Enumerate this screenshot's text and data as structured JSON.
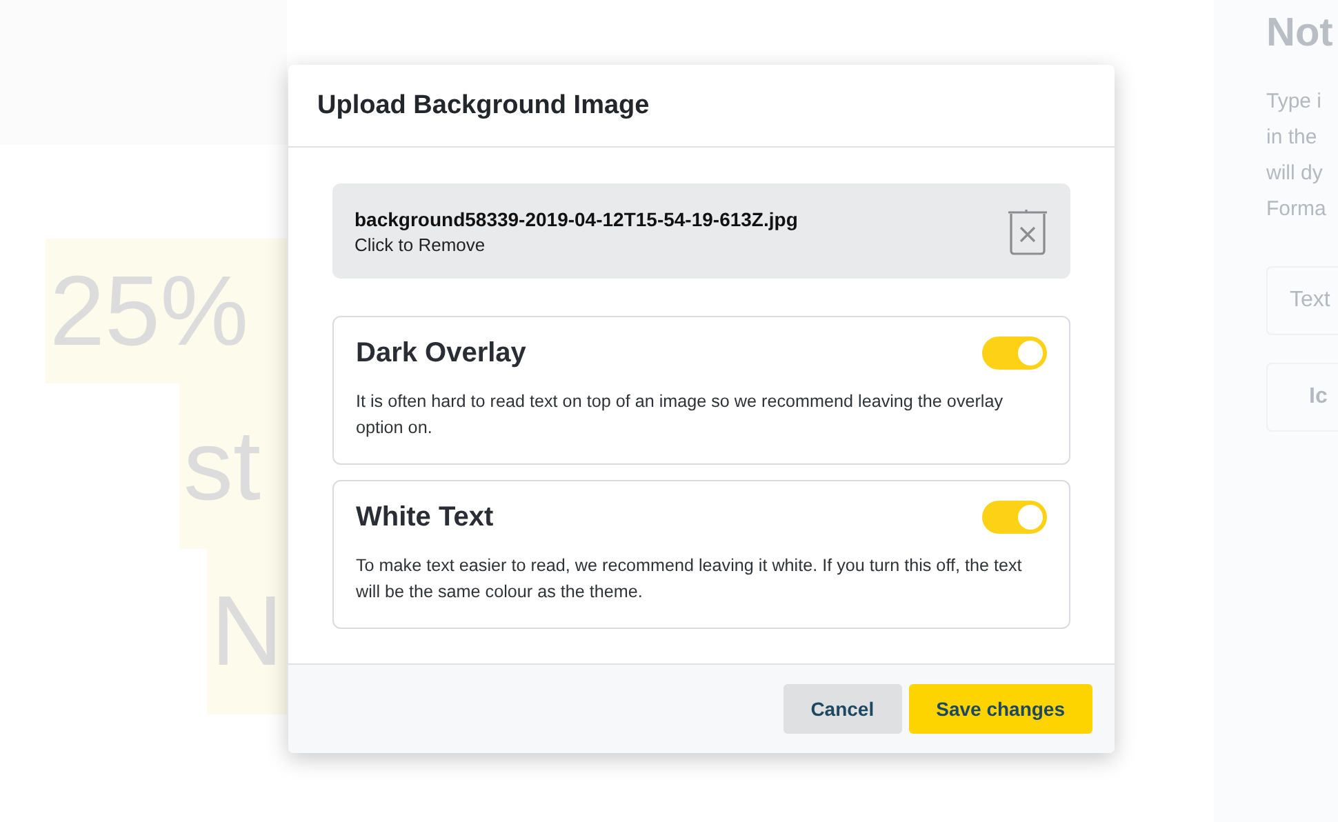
{
  "background": {
    "headline_lines": [
      "25%",
      "st",
      "N"
    ],
    "side_panel": {
      "title": "Not",
      "description_lines": [
        "Type i",
        "in the",
        "will dy",
        "Forma"
      ],
      "buttons": [
        {
          "label": "Text",
          "kind": "field"
        },
        {
          "label": "Ic",
          "kind": "button"
        }
      ]
    }
  },
  "dialog": {
    "title": "Upload Background Image",
    "file": {
      "name": "background58339-2019-04-12T15-54-19-613Z.jpg",
      "action": "Click to Remove"
    },
    "options": [
      {
        "title": "Dark Overlay",
        "description": "It is often hard to read text on top of an image so we recommend leaving the overlay option on.",
        "on": true
      },
      {
        "title": "White Text",
        "description": "To make text easier to read, we recommend leaving it white. If you turn this off, the text will be the same colour as the theme.",
        "on": true
      }
    ],
    "buttons": [
      {
        "label": "Cancel",
        "kind": "secondary"
      },
      {
        "label": "Save changes",
        "kind": "primary"
      }
    ]
  }
}
